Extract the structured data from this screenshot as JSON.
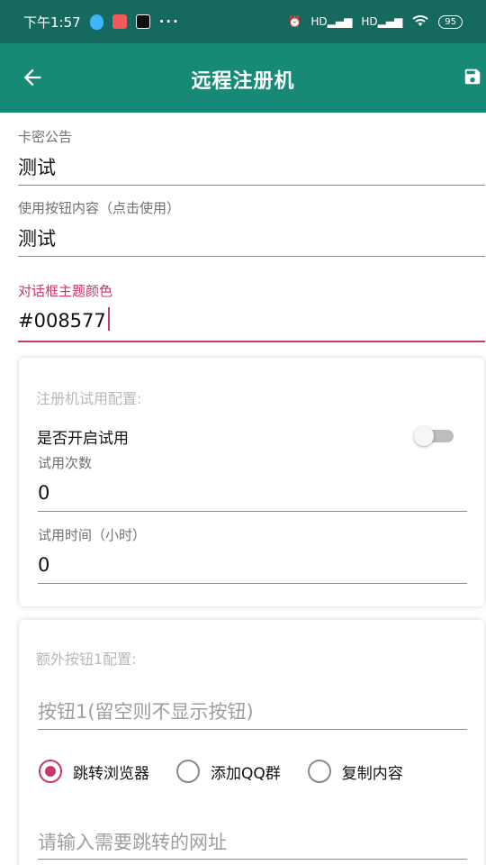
{
  "status_bar": {
    "time": "下午1:57",
    "network": "HD",
    "battery": "95"
  },
  "app_bar": {
    "title": "远程注册机"
  },
  "fields": {
    "notice": {
      "label": "卡密公告",
      "value": "测试"
    },
    "use_button": {
      "label": "使用按钮内容（点击使用）",
      "value": "测试"
    },
    "dialog_color": {
      "label": "对话框主题颜色",
      "value": "#008577"
    }
  },
  "trial_card": {
    "title": "注册机试用配置:",
    "toggle_label": "是否开启试用",
    "toggle_on": false,
    "count": {
      "label": "试用次数",
      "value": "0"
    },
    "hours": {
      "label": "试用时间（小时）",
      "value": "0"
    }
  },
  "extra_button_card": {
    "title": "额外按钮1配置:",
    "name_placeholder": "按钮1(留空则不显示按钮)",
    "options": [
      "跳转浏览器",
      "添加QQ群",
      "复制内容"
    ],
    "selected": "跳转浏览器",
    "url_placeholder": "请输入需要跳转的网址"
  },
  "colors": {
    "status_bar": "#15695e",
    "app_bar": "#168a77",
    "accent": "#c53a6a"
  }
}
